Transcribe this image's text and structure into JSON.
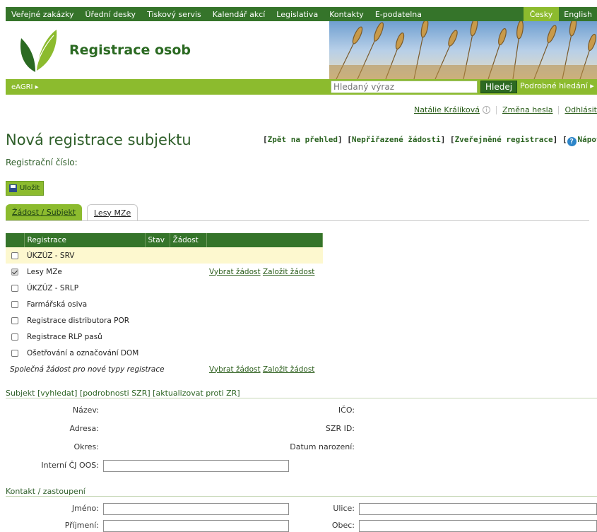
{
  "topnav": {
    "items": [
      "Veřejné zakázky",
      "Úřední desky",
      "Tiskový servis",
      "Kalendář akcí",
      "Legislativa",
      "Kontakty",
      "E-podatelna"
    ],
    "lang_active": "Česky",
    "lang_other": "English"
  },
  "header": {
    "app_title": "Registrace osob"
  },
  "searchbar": {
    "eagri_label": "eAGRI ▸",
    "search_placeholder": "Hledaný výraz",
    "search_button": "Hledej",
    "advanced_search": "Podrobné hledání ▸"
  },
  "user": {
    "name": "Natálie Králíková",
    "change_password": "Změna hesla",
    "logout": "Odhlásit"
  },
  "page": {
    "title": "Nová registrace subjektu",
    "quicklinks": [
      "Zpět na přehled",
      "Nepřiřazené žádosti",
      "Zveřejněné registrace",
      "Nápověda"
    ],
    "reg_number_label": "Registrační číslo:",
    "save_button": "Uložit"
  },
  "tabs": [
    "Žádost / Subjekt",
    "Lesy MZe"
  ],
  "table": {
    "headers": [
      "Registrace",
      "Stav",
      "Žádost"
    ],
    "rows": [
      {
        "label": "ÚKZÚZ - SRV",
        "checked": false,
        "highlight": true,
        "actions": []
      },
      {
        "label": "Lesy MZe",
        "checked": true,
        "highlight": false,
        "actions": [
          "Vybrat žádost",
          "Založit žádost"
        ]
      },
      {
        "label": "ÚKZÚZ - SRLP",
        "checked": false,
        "highlight": false,
        "actions": []
      },
      {
        "label": "Farmářská osiva",
        "checked": false,
        "highlight": false,
        "actions": []
      },
      {
        "label": "Registrace distributora POR",
        "checked": false,
        "highlight": false,
        "actions": []
      },
      {
        "label": "Registrace RLP pasů",
        "checked": false,
        "highlight": false,
        "actions": []
      },
      {
        "label": "Ošetřování a označování DOM",
        "checked": false,
        "highlight": false,
        "actions": []
      }
    ],
    "common_row": {
      "label": "Společná žádost pro nové typy registrace",
      "actions": [
        "Vybrat žádost",
        "Založit žádost"
      ]
    }
  },
  "subject": {
    "heading": "Subjekt",
    "links": [
      "vyhledat",
      "podrobnosti SZR",
      "aktualizovat proti ZR"
    ],
    "fields_left": [
      "Název:",
      "Adresa:",
      "Okres:",
      "Interní ČJ OOS:"
    ],
    "fields_right": [
      "IČO:",
      "SZR ID:",
      "Datum narození:"
    ]
  },
  "contact": {
    "heading": "Kontakt / zastoupení",
    "fields_left": [
      "Jméno:",
      "Příjmení:"
    ],
    "fields_right": [
      "Ulice:",
      "Obec:"
    ]
  },
  "colors": {
    "dark_green": "#35742a",
    "light_green": "#8cbb2e",
    "highlight_row": "#fdf8cf"
  }
}
